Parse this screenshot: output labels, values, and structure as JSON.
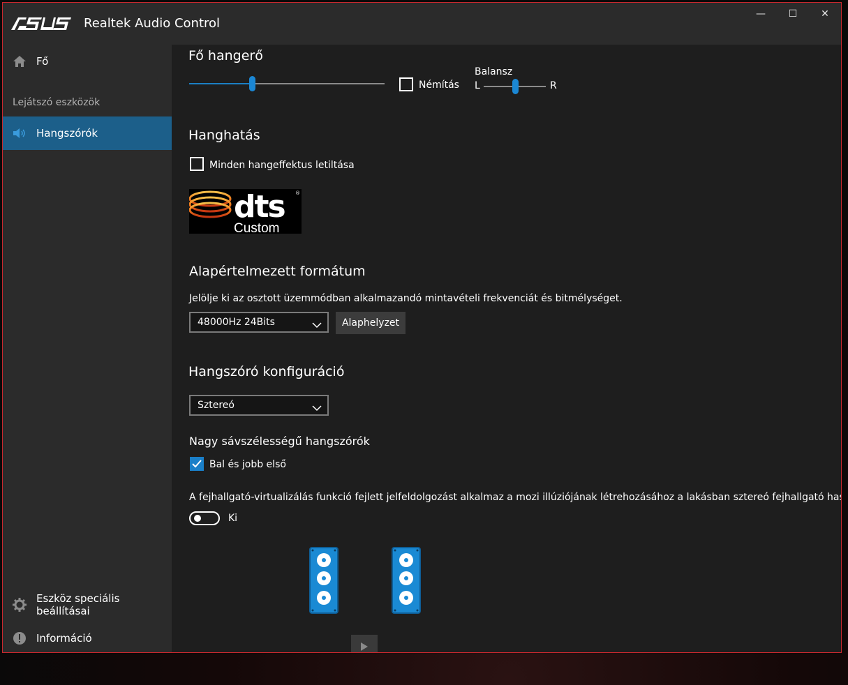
{
  "app": {
    "brand": "ASUS",
    "title": "Realtek Audio Control"
  },
  "window_controls": {
    "minimize": "—",
    "maximize": "☐",
    "close": "✕"
  },
  "sidebar": {
    "home_label": "Fő",
    "section_label": "Lejátszó eszközök",
    "active_item_label": "Hangszórók",
    "advanced_label": "Eszköz speciális beállításai",
    "info_label": "Információ"
  },
  "main_volume": {
    "heading": "Fő hangerő",
    "level": 0.32,
    "mute_label": "Némítás",
    "mute_checked": false,
    "balance_label": "Balansz",
    "balance_left": "L",
    "balance_right": "R",
    "balance_value": 0.5
  },
  "sound_effects": {
    "heading": "Hanghatás",
    "disable_all_label": "Minden hangeffektus letiltása",
    "disable_all_checked": false,
    "dts_word": "dts",
    "dts_sub": "Custom",
    "dts_mark": "®"
  },
  "default_format": {
    "heading": "Alapértelmezett formátum",
    "description": "Jelölje ki az osztott üzemmódban alkalmazandó mintavételi frekvenciát és bitmélységet.",
    "selected": "48000Hz 24Bits",
    "reset_label": "Alaphelyzet"
  },
  "speaker_config": {
    "heading": "Hangszóró konfiguráció",
    "selected": "Sztereó",
    "fullrange_heading": "Nagy sávszélességű hangszórók",
    "front_lr_label": "Bal és jobb első",
    "front_lr_checked": true,
    "virtualization_text": "A fejhallgató-virtualizálás funkció fejlett jelfeldolgozást alkalmaz a mozi illúziójának létrehozásához a lakásban sztereó fejhallgató használata n",
    "toggle_state": "Ki",
    "toggle_on": false
  },
  "colors": {
    "accent": "#1b87d4",
    "sidebar_active": "#1c5f8a",
    "window_border": "#c8282e",
    "speaker_blue": "#1a8ad4"
  },
  "icons": {
    "home": "home-icon",
    "speaker": "speaker-icon",
    "gear": "gear-icon",
    "info": "info-icon",
    "chevron": "chevron-down-icon",
    "play": "play-icon"
  }
}
